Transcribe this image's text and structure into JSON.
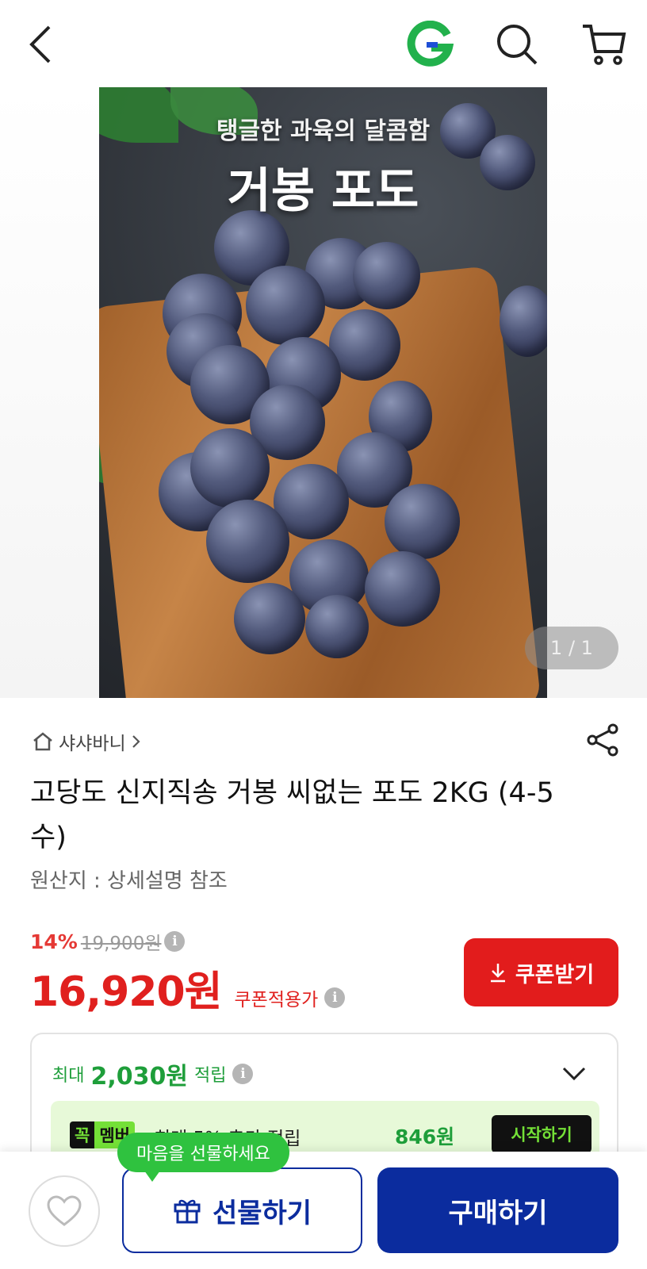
{
  "header": {
    "back_icon": "chevron-left-icon",
    "logo_letter": "G",
    "search_icon": "search-icon",
    "cart_icon": "cart-icon",
    "brand_color": "#22b14c"
  },
  "hero": {
    "promo_subtitle": "탱글한 과육의 달콤함",
    "promo_title": "거봉 포도",
    "counter": "1 / 1"
  },
  "product": {
    "store_name": "샤샤바니",
    "title": "고당도 신지직송 거봉 씨없는 포도 2KG (4-5수)",
    "origin": "원산지 : 상세설명 참조",
    "discount": "14%",
    "original_price": "19,900원",
    "price": "16,920원",
    "coupon_note": "쿠폰적용가",
    "coupon_button": "쿠폰받기",
    "accent_color": "#e0201e"
  },
  "reward": {
    "prefix": "최대",
    "amount": "2,030원",
    "suffix": "적립",
    "member_logo_a": "꼭",
    "member_logo_b": "멤버",
    "member_text": "최대 5% 추가 적립",
    "member_amount": "846원",
    "member_start": "시작하기"
  },
  "bottom_bar": {
    "tooltip": "마음을 선물하세요",
    "gift_label": "선물하기",
    "buy_label": "구매하기",
    "button_color": "#0b2c9e"
  }
}
